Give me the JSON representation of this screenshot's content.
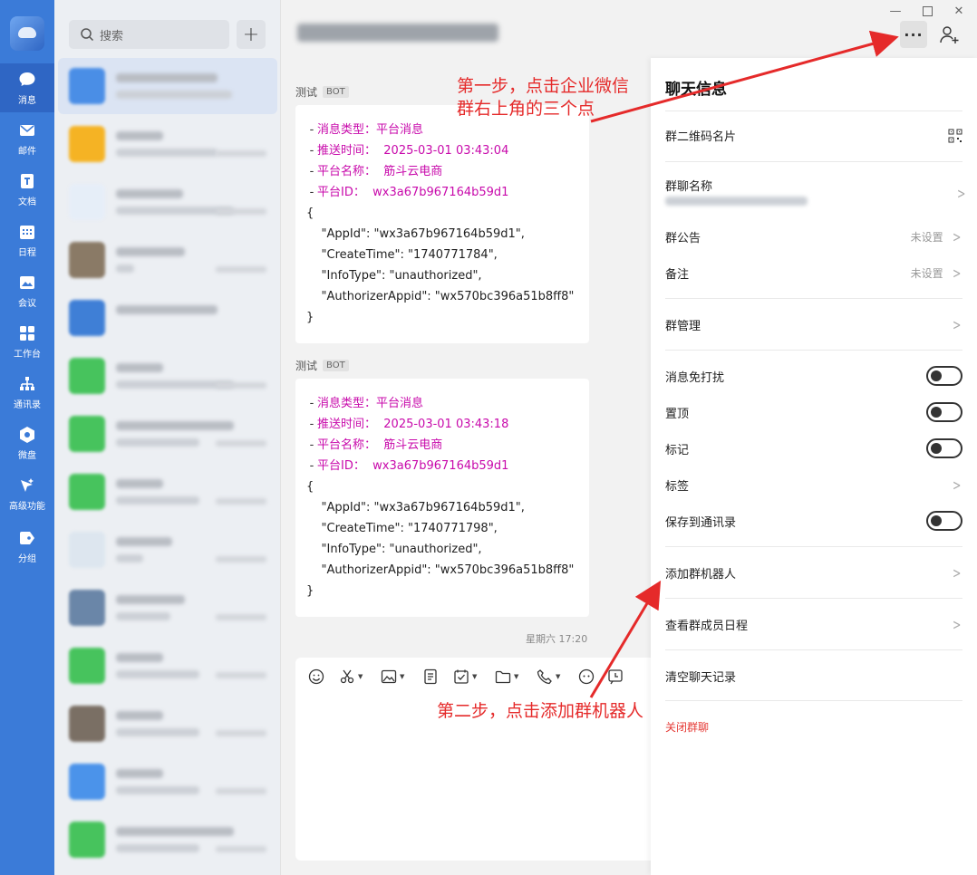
{
  "nav": {
    "items": [
      {
        "label": "消息",
        "icon": "chat-bubble-icon"
      },
      {
        "label": "邮件",
        "icon": "mail-icon"
      },
      {
        "label": "文档",
        "icon": "document-icon"
      },
      {
        "label": "日程",
        "icon": "calendar-icon"
      },
      {
        "label": "会议",
        "icon": "meeting-icon"
      },
      {
        "label": "工作台",
        "icon": "workbench-icon"
      },
      {
        "label": "通讯录",
        "icon": "contacts-icon"
      },
      {
        "label": "微盘",
        "icon": "drive-icon"
      },
      {
        "label": "高级功能",
        "icon": "advanced-icon"
      },
      {
        "label": "分组",
        "icon": "tag-icon"
      }
    ]
  },
  "search": {
    "placeholder": "搜索"
  },
  "chat": {
    "sender_name": "测试",
    "sender_badge": "BOT",
    "messages": [
      {
        "lines": [
          {
            "label": "消息类型：",
            "value": "平台消息"
          },
          {
            "label": "推送时间：",
            "value": "2025-03-01 03:43:04"
          },
          {
            "label": "平台名称：",
            "value": "筋斗云电商"
          },
          {
            "label": "平台ID：",
            "value": "wx3a67b967164b59d1"
          }
        ],
        "json": "{\n    \"AppId\": \"wx3a67b967164b59d1\",\n    \"CreateTime\": \"1740771784\",\n    \"InfoType\": \"unauthorized\",\n    \"AuthorizerAppid\": \"wx570bc396a51b8ff8\"\n}"
      },
      {
        "lines": [
          {
            "label": "消息类型：",
            "value": "平台消息"
          },
          {
            "label": "推送时间：",
            "value": "2025-03-01 03:43:18"
          },
          {
            "label": "平台名称：",
            "value": "筋斗云电商"
          },
          {
            "label": "平台ID：",
            "value": "wx3a67b967164b59d1"
          }
        ],
        "json": "{\n    \"AppId\": \"wx3a67b967164b59d1\",\n    \"CreateTime\": \"1740771798\",\n    \"InfoType\": \"unauthorized\",\n    \"AuthorizerAppid\": \"wx570bc396a51b8ff8\"\n}"
      }
    ],
    "timestamp": "星期六 17:20"
  },
  "panel": {
    "title": "聊天信息",
    "qr_label": "群二维码名片",
    "group_name_label": "群聊名称",
    "announcement_label": "群公告",
    "announcement_value": "未设置",
    "remark_label": "备注",
    "remark_value": "未设置",
    "manage_label": "群管理",
    "mute_label": "消息免打扰",
    "pin_label": "置顶",
    "mark_label": "标记",
    "tag_label": "标签",
    "save_contacts_label": "保存到通讯录",
    "add_bot_label": "添加群机器人",
    "schedule_label": "查看群成员日程",
    "clear_label": "清空聊天记录",
    "close_label": "关闭群聊"
  },
  "annotations": {
    "step1_line1": "第一步，点击企业微信",
    "step1_line2": "群右上角的三个点",
    "step2": "第二步，点击添加群机器人"
  },
  "colors": {
    "rail": "#3b7bd8",
    "meta_text": "#c80aab",
    "annotation": "#e52a2a",
    "close_group": "#e53935"
  }
}
